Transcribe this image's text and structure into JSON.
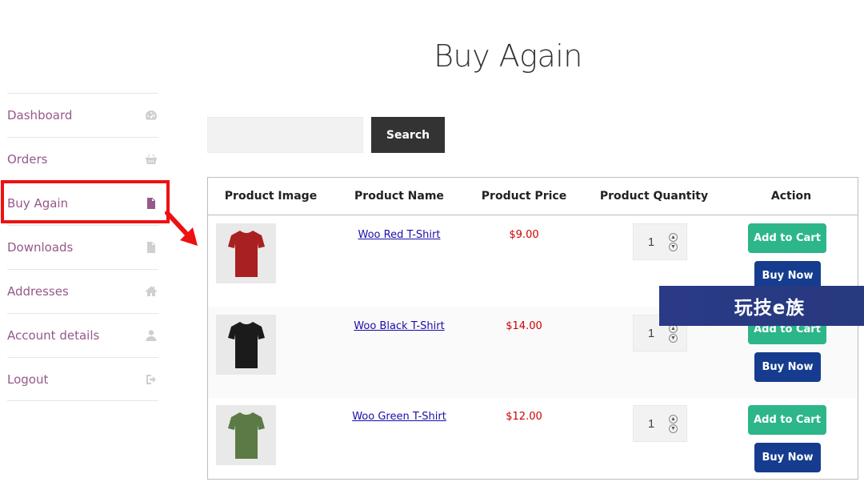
{
  "page_title": "Buy Again",
  "sidebar": {
    "items": [
      {
        "label": "Dashboard",
        "icon": "dashboard-gauge-icon",
        "active": false
      },
      {
        "label": "Orders",
        "icon": "basket-icon",
        "active": false
      },
      {
        "label": "Buy Again",
        "icon": "document-icon",
        "active": true
      },
      {
        "label": "Downloads",
        "icon": "file-download-icon",
        "active": false
      },
      {
        "label": "Addresses",
        "icon": "home-icon",
        "active": false
      },
      {
        "label": "Account details",
        "icon": "user-icon",
        "active": false
      },
      {
        "label": "Logout",
        "icon": "logout-icon",
        "active": false
      }
    ]
  },
  "search": {
    "placeholder": "",
    "value": "",
    "button_label": "Search"
  },
  "table": {
    "headers": [
      "Product Image",
      "Product Name",
      "Product Price",
      "Product Quantity",
      "Action"
    ],
    "rows": [
      {
        "name": "Woo Red T-Shirt",
        "price": "$9.00",
        "quantity": "1",
        "shirt_color": "#a8201f",
        "add_label": "Add to Cart",
        "buy_label": "Buy Now"
      },
      {
        "name": "Woo Black T-Shirt",
        "price": "$14.00",
        "quantity": "1",
        "shirt_color": "#1b1b1b",
        "add_label": "Add to Cart",
        "buy_label": "Buy Now"
      },
      {
        "name": "Woo Green T-Shirt",
        "price": "$12.00",
        "quantity": "1",
        "shirt_color": "#5c7a45",
        "add_label": "Add to Cart",
        "buy_label": "Buy Now"
      }
    ]
  },
  "watermark": {
    "text": "玩技e族"
  },
  "colors": {
    "accent": "#96588a",
    "add_to_cart": "#2cb68a",
    "buy_now": "#153c8e",
    "price": "#cc0000",
    "highlight": "#ee1111",
    "search_button": "#333333"
  }
}
